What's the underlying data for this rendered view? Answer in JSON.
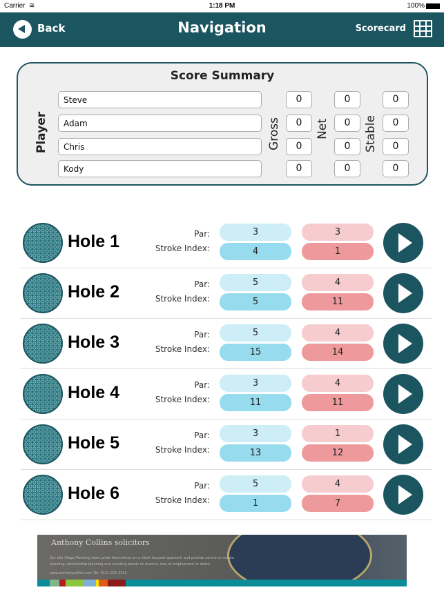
{
  "status_bar": {
    "carrier": "Carrier",
    "time": "1:18 PM",
    "battery": "100%"
  },
  "nav": {
    "back": "Back",
    "title": "Navigation",
    "scorecard": "Scorecard"
  },
  "summary": {
    "title": "Score Summary",
    "player_label": "Player",
    "gross_label": "Gross",
    "net_label": "Net",
    "stable_label": "Stable",
    "players": [
      {
        "name": "Steve",
        "gross": "0",
        "net": "0",
        "stable": "0"
      },
      {
        "name": "Adam",
        "gross": "0",
        "net": "0",
        "stable": "0"
      },
      {
        "name": "Chris",
        "gross": "0",
        "net": "0",
        "stable": "0"
      },
      {
        "name": "Kody",
        "gross": "0",
        "net": "0",
        "stable": "0"
      }
    ]
  },
  "labels": {
    "par": "Par:",
    "stroke_index": "Stroke Index:"
  },
  "holes": [
    {
      "name": "Hole 1",
      "par1": "3",
      "si1": "4",
      "par2": "3",
      "si2": "1"
    },
    {
      "name": "Hole 2",
      "par1": "5",
      "si1": "5",
      "par2": "4",
      "si2": "11"
    },
    {
      "name": "Hole 3",
      "par1": "5",
      "si1": "15",
      "par2": "4",
      "si2": "14"
    },
    {
      "name": "Hole 4",
      "par1": "3",
      "si1": "11",
      "par2": "4",
      "si2": "11"
    },
    {
      "name": "Hole 5",
      "par1": "3",
      "si1": "13",
      "par2": "1",
      "si2": "12"
    },
    {
      "name": "Hole 6",
      "par1": "5",
      "si1": "1",
      "par2": "4",
      "si2": "7"
    }
  ],
  "ad": {
    "logo": "Anthony Collins solicitors",
    "text": "Our Life Stage Planning team pride themselves on a client focused approach and provide advice on estate planning, relationship planning and securing assets on divorce, loss of employment or death.",
    "contact": "www.anthonycollins.com    Tel: 0121 200 3242"
  },
  "colors": {
    "nav": "#1b5560",
    "par_blue": "#cdeef6",
    "si_blue": "#96dcee",
    "par_pink": "#f6cccf",
    "si_pink": "#ee9a9c"
  }
}
